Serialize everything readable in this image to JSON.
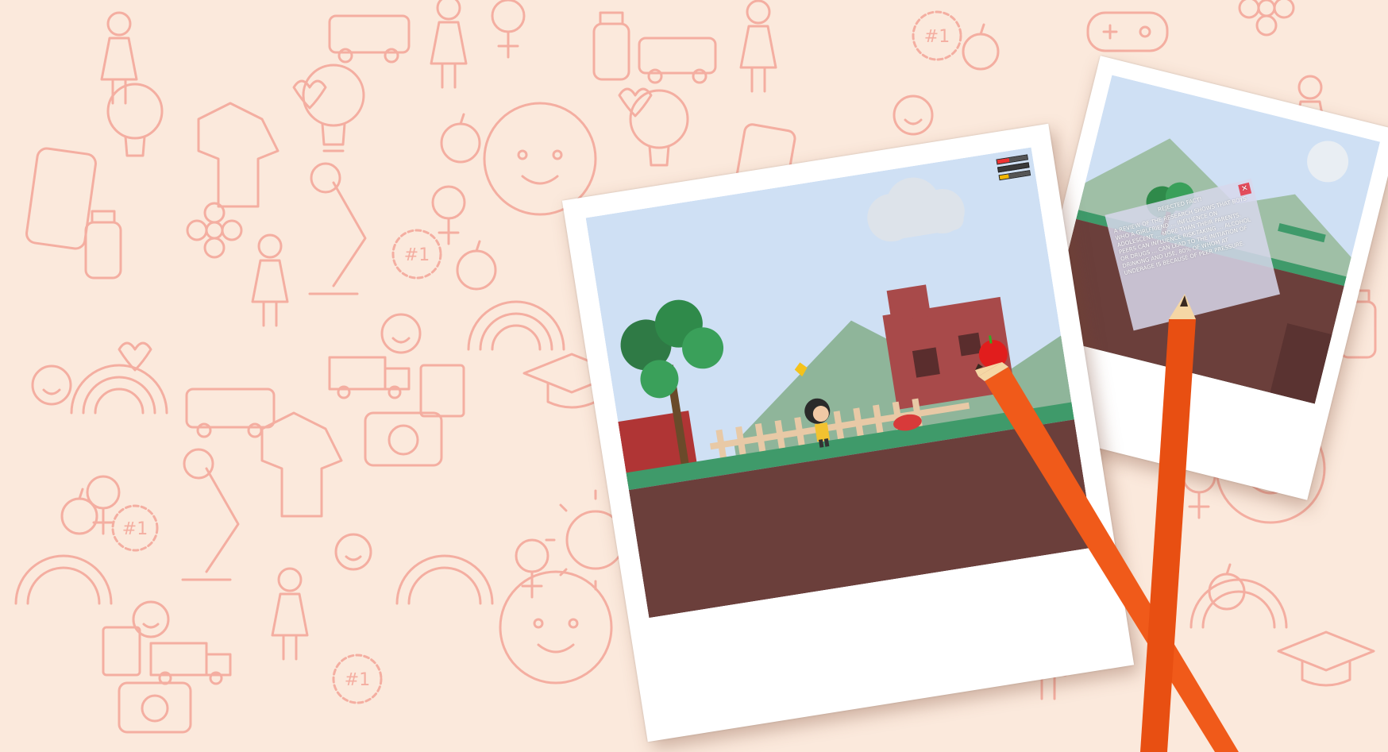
{
  "colors": {
    "background": "#fbe9dc",
    "doodle": "#f3a89a",
    "sky": "#cfe0f4",
    "ground": "#6b3f3b",
    "grass": "#3f9a6a",
    "pencil": "#f05a1a"
  },
  "icons": [
    "lightbulb-icon",
    "apple-icon",
    "school-bus-icon",
    "rainbow-icon",
    "camera-icon",
    "girl-face-icon",
    "rosette-number-one-icon",
    "trophy-icon",
    "smiley-icon",
    "female-symbol-icon"
  ],
  "doodle_text": {
    "rosette": "#1"
  },
  "fact_popup": {
    "title": "REJECTED FACT!",
    "body": "A REVIEW OF THE RESEARCH SHOWS THAT BOYS WHO A GIRLFRIEND ... INFLUENCE ON ADOLESCENT ... MORE THAN THEIR PARENTS. PEERS CAN INFLUENCE RISK-TAKING ... ALCOHOL OR DRUGS ... CAN LEAD TO THE INITIATION OF DRINKING AND USE, 80% OF WHOM AT UNDERAGE IS BECAUSE OF PEER PRESSURE.",
    "close": "✕"
  }
}
